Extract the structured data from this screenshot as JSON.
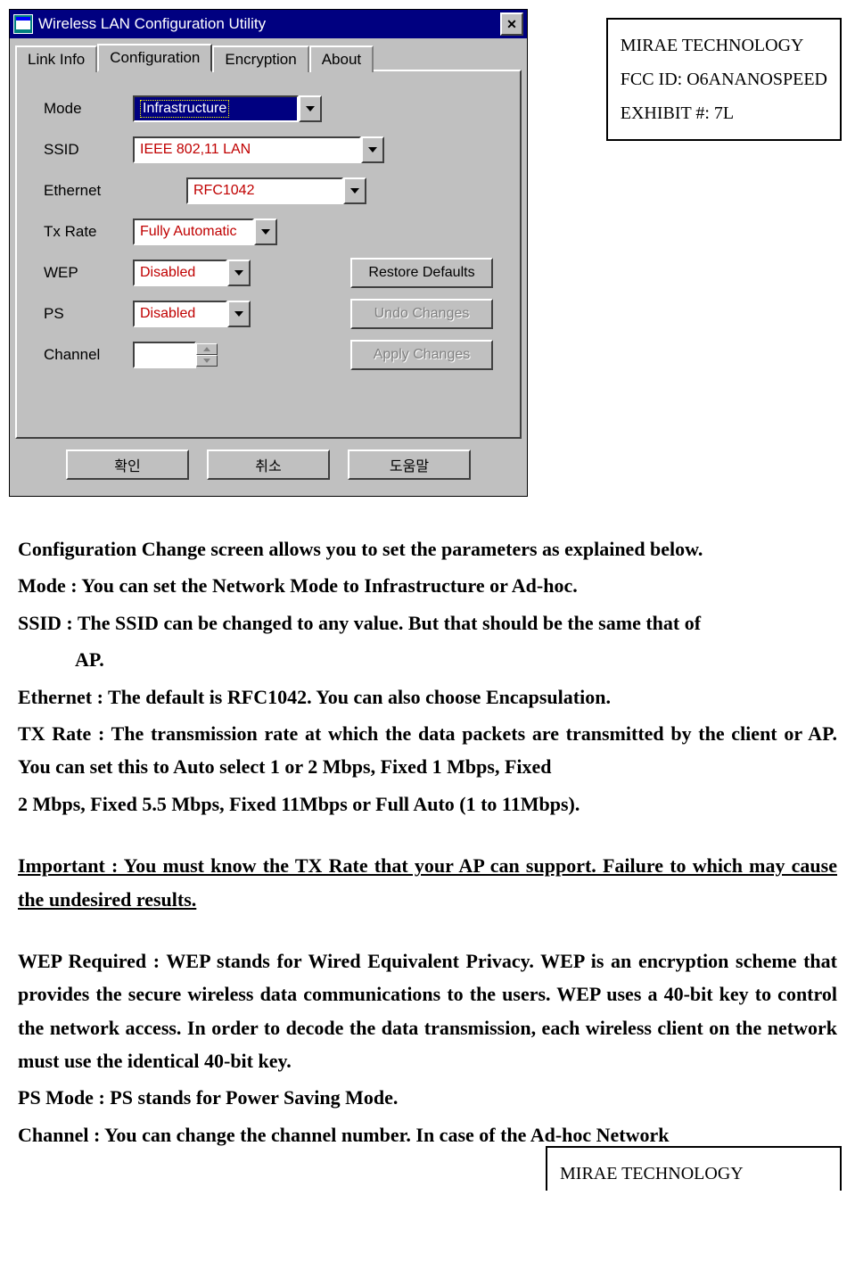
{
  "header": {
    "line1": "MIRAE TECHNOLOGY",
    "line2": "FCC ID:  O6ANANOSPEED",
    "line3": "EXHIBIT #: 7L"
  },
  "footer": {
    "line1": "MIRAE TECHNOLOGY"
  },
  "window": {
    "title": "Wireless LAN Configuration Utility",
    "tabs": {
      "link_info": "Link Info",
      "configuration": "Configuration",
      "encryption": "Encryption",
      "about": "About"
    },
    "form": {
      "mode_label": "Mode",
      "mode_value": "Infrastructure",
      "ssid_label": "SSID",
      "ssid_value": "IEEE 802,11 LAN",
      "ethernet_label": "Ethernet",
      "ethernet_value": "RFC1042",
      "txrate_label": "Tx Rate",
      "txrate_value": "Fully Automatic",
      "wep_label": "WEP",
      "wep_value": "Disabled",
      "ps_label": "PS",
      "ps_value": "Disabled",
      "channel_label": "Channel",
      "channel_value": ""
    },
    "buttons": {
      "restore": "Restore Defaults",
      "undo": "Undo Changes",
      "apply": "Apply Changes",
      "ok": "확인",
      "cancel": "취소",
      "help": "도움말"
    }
  },
  "doc": {
    "p1": "Configuration Change screen allows you to set the parameters as explained below.",
    "p2": "Mode : You can set the Network Mode to Infrastructure or Ad-hoc.",
    "p3a": "SSID : The SSID can be changed to any value. But that should be the same that of",
    "p3b": "AP.",
    "p4": "Ethernet : The default is RFC1042. You can also choose Encapsulation.",
    "p5": "TX Rate : The transmission rate at which the data packets are transmitted by the client or AP. You can set this to Auto select 1 or 2 Mbps, Fixed 1 Mbps, Fixed",
    "p6": "2 Mbps, Fixed 5.5 Mbps, Fixed 11Mbps or Full Auto (1 to 11Mbps).",
    "p7": "Important : You must know the TX Rate that your AP can support. Failure to which may cause the undesired results.",
    "p8": "WEP Required : WEP stands for Wired Equivalent Privacy. WEP is an encryption scheme that provides the secure wireless data communications to the users. WEP uses a 40-bit key to control the network access. In order to decode the data transmission, each wireless client on the network must use the identical 40-bit key.",
    "p9": "PS Mode : PS stands for Power Saving Mode.",
    "p10": "Channel : You can change the channel number. In case of the Ad-hoc Network"
  }
}
